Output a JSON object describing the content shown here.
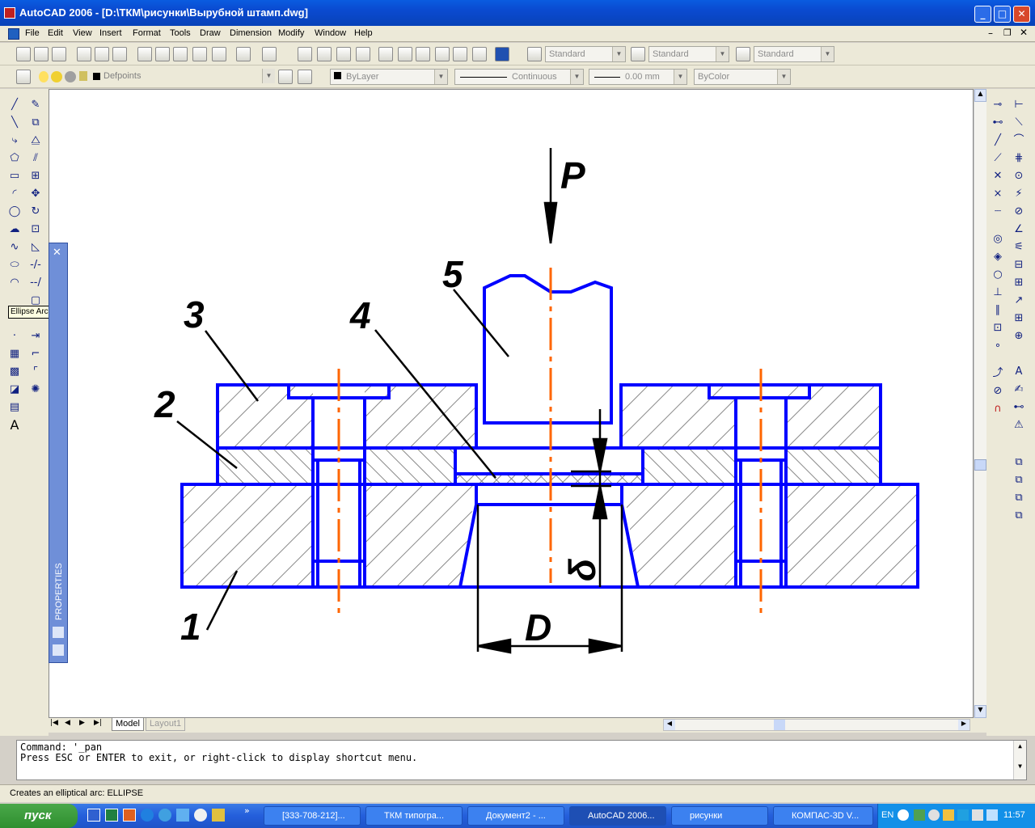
{
  "window": {
    "title": "AutoCAD 2006 - [D:\\ТКМ\\рисунки\\Вырубной штамп.dwg]",
    "min_label": "_",
    "max_label": "□",
    "close_label": "✕"
  },
  "menu": [
    "File",
    "Edit",
    "View",
    "Insert",
    "Format",
    "Tools",
    "Draw",
    "Dimension",
    "Modify",
    "Window",
    "Help"
  ],
  "styles": {
    "text_style": "Standard",
    "dim_style": "Standard",
    "table_style": "Standard"
  },
  "layers": {
    "current": "Defpoints",
    "color": "ByLayer",
    "linetype": "Continuous",
    "lineweight": "0.00 mm",
    "plotstyle": "ByColor"
  },
  "tooltip": "Ellipse Arc",
  "palette": {
    "title": "PROPERTIES"
  },
  "tabs": {
    "model": "Model",
    "layout": "Layout1"
  },
  "drawing": {
    "labels": {
      "p": "P",
      "n1": "1",
      "n2": "2",
      "n3": "3",
      "n4": "4",
      "n5": "5",
      "d": "D",
      "delta": "δ"
    },
    "outline_color": "#0000ff",
    "axis_color": "#ff6600"
  },
  "command": {
    "line1": "Command: '_pan",
    "line2": "Press ESC or ENTER to exit, or right-click to display shortcut menu."
  },
  "status": "Creates an elliptical arc:  ELLIPSE",
  "taskbar": {
    "start": "пуск",
    "tasks": [
      "[333-708-212]...",
      "ТКМ типогра...",
      "Документ2 - ...",
      "AutoCAD 2006...",
      "рисунки",
      "КОМПАС-3D V..."
    ],
    "active": 3,
    "lang": "EN",
    "clock": "11:57"
  }
}
